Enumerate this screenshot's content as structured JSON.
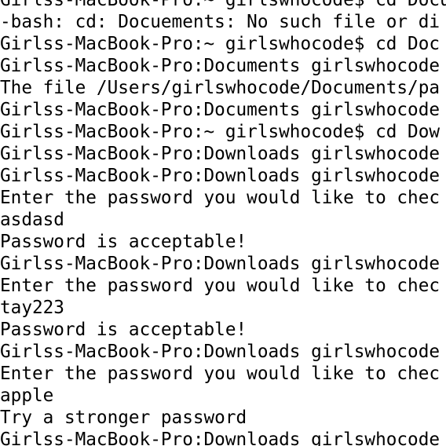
{
  "terminal": {
    "background": "#ffffff",
    "text_color": "#000000",
    "lines": [
      "Girlss-MacBook-Pro:~ girlswhocode$ cd Docu",
      "-bash: cd: Docuements: No such file or di",
      "Girlss-MacBook-Pro:~ girlswhocode$ cd Doc",
      "Girlss-MacBook-Pro:Documents girlswhocode",
      "The file /Users/girlswhocode/Documents/pa",
      "Girlss-MacBook-Pro:Documents girlswhocode",
      "Girlss-MacBook-Pro:~ girlswhocode$ cd Dow",
      "Girlss-MacBook-Pro:Downloads girlswhocode",
      "Girlss-MacBook-Pro:Downloads girlswhocode",
      "Enter the password you would like to chec",
      "asdasd",
      "Password is acceptable!",
      "Girlss-MacBook-Pro:Downloads girlswhocode",
      "Enter the password you would like to chec",
      "tay223",
      "Password is acceptable!",
      "Girlss-MacBook-Pro:Downloads girlswhocode",
      "Enter the password you would like to chec",
      "apple",
      "Try a stronger password",
      "Girlss-MacBook-Pro:Downloads girlswhocode"
    ]
  }
}
